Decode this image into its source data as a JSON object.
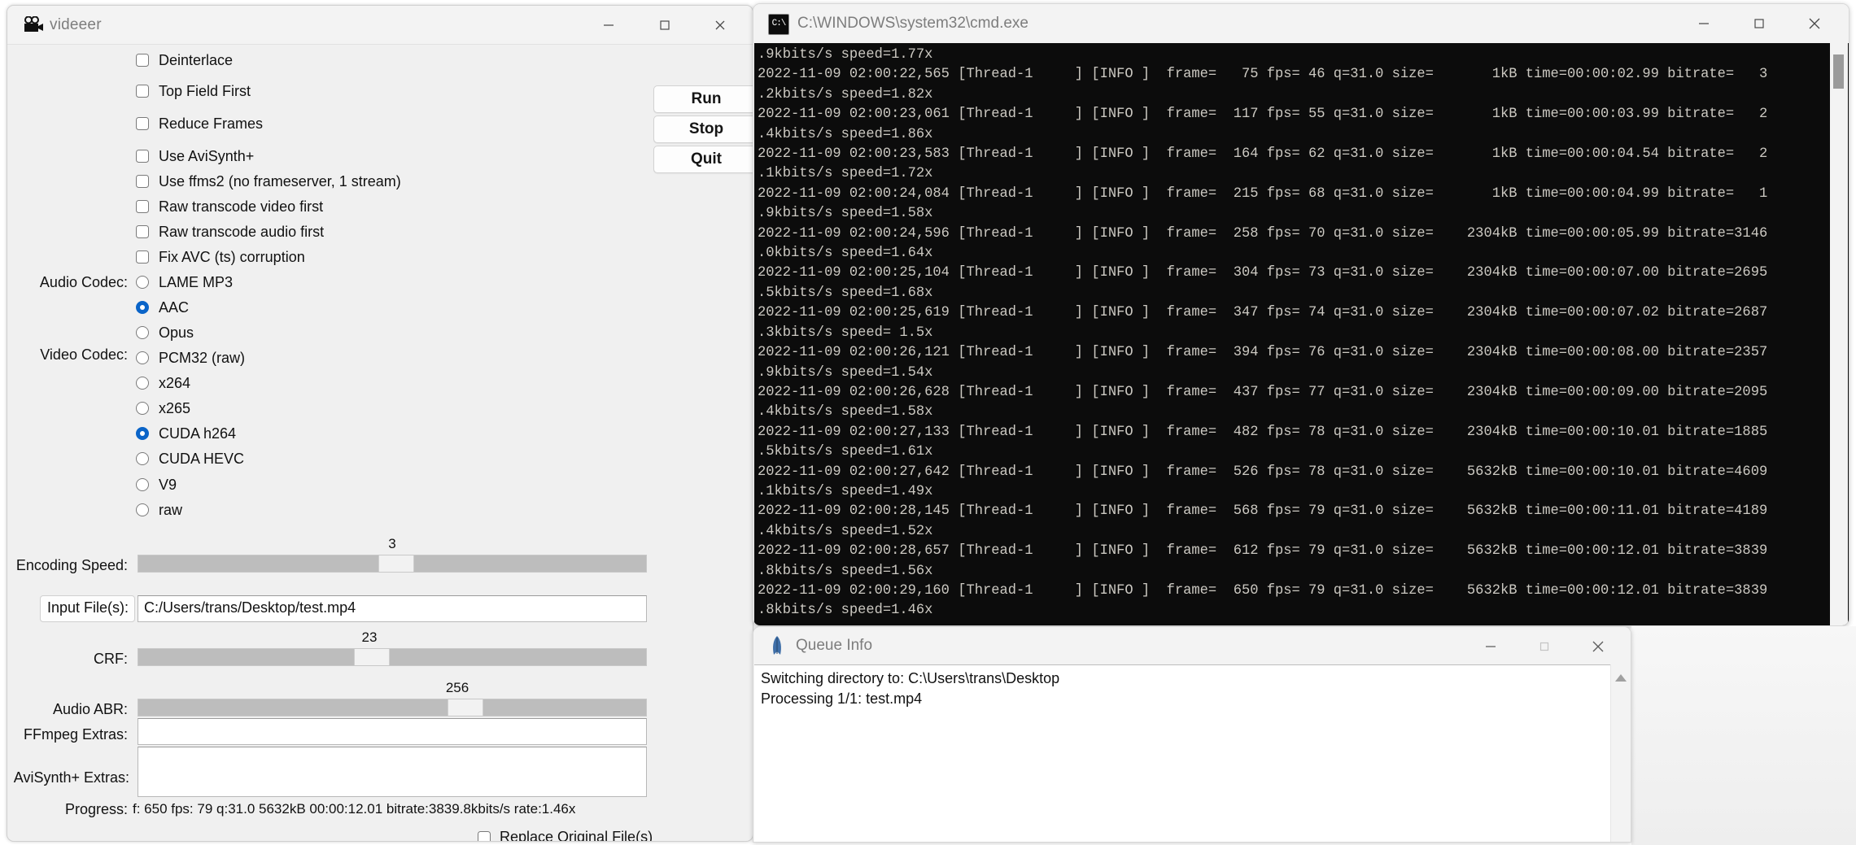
{
  "videeer": {
    "title": "videeer",
    "icon": "video-camera-icon",
    "window_controls": {
      "minimize": "—",
      "maximize": "□",
      "close": "✕"
    },
    "checkboxes": [
      {
        "label": "Deinterlace",
        "checked": false
      },
      {
        "label": "Top Field First",
        "checked": false
      },
      {
        "label": "Reduce Frames",
        "checked": false
      },
      {
        "label": "Use AviSynth+",
        "checked": false
      },
      {
        "label": "Use ffms2 (no frameserver, 1 stream)",
        "checked": false
      },
      {
        "label": "Raw transcode video first",
        "checked": false
      },
      {
        "label": "Raw transcode audio first",
        "checked": false
      },
      {
        "label": "Fix AVC (ts) corruption",
        "checked": false
      }
    ],
    "audio_codec_label": "Audio Codec:",
    "video_codec_label": "Video Codec:",
    "radios": [
      {
        "label": "LAME MP3",
        "selected": false
      },
      {
        "label": "AAC",
        "selected": true
      },
      {
        "label": "Opus",
        "selected": false
      },
      {
        "label": "PCM32 (raw)",
        "selected": false
      },
      {
        "label": "x264",
        "selected": false
      },
      {
        "label": "x265",
        "selected": false
      },
      {
        "label": "CUDA h264",
        "selected": true
      },
      {
        "label": "CUDA HEVC",
        "selected": false
      },
      {
        "label": "V9",
        "selected": false
      },
      {
        "label": "raw",
        "selected": false
      }
    ],
    "buttons": {
      "run": "Run",
      "stop": "Stop",
      "quit": "Quit"
    },
    "sliders": [
      {
        "name": "Encoding Speed:",
        "value": "3"
      },
      {
        "name": "CRF:",
        "value": "23"
      },
      {
        "name": "Audio ABR:",
        "value": "256"
      }
    ],
    "input_file_label": "Input File(s):",
    "input_file_value": "C:/Users/trans/Desktop/test.mp4",
    "ffmpeg_extras_label": "FFmpeg Extras:",
    "ffmpeg_extras_value": "",
    "avisynth_extras_label": "AviSynth+ Extras:",
    "avisynth_extras_value": "",
    "progress_label": "Progress:",
    "progress_text": "f:  650 fps: 79 q:31.0  5632kB 00:00:12.01 bitrate:3839.8kbits/s rate:1.46x",
    "replace_original_label": "Replace Original File(s)",
    "replace_original_checked": false,
    "accent_color": "#0a64c8"
  },
  "cmd": {
    "title": "C:\\WINDOWS\\system32\\cmd.exe",
    "icon": "console-icon",
    "window_controls": {
      "minimize": "—",
      "maximize": "□",
      "close": "✕"
    },
    "lines": [
      ".9kbits/s speed=1.77x",
      "2022-11-09 02:00:22,565 [Thread-1     ] [INFO ]  frame=   75 fps= 46 q=31.0 size=       1kB time=00:00:02.99 bitrate=   3",
      ".2kbits/s speed=1.82x",
      "2022-11-09 02:00:23,061 [Thread-1     ] [INFO ]  frame=  117 fps= 55 q=31.0 size=       1kB time=00:00:03.99 bitrate=   2",
      ".4kbits/s speed=1.86x",
      "2022-11-09 02:00:23,583 [Thread-1     ] [INFO ]  frame=  164 fps= 62 q=31.0 size=       1kB time=00:00:04.54 bitrate=   2",
      ".1kbits/s speed=1.72x",
      "2022-11-09 02:00:24,084 [Thread-1     ] [INFO ]  frame=  215 fps= 68 q=31.0 size=       1kB time=00:00:04.99 bitrate=   1",
      ".9kbits/s speed=1.58x",
      "2022-11-09 02:00:24,596 [Thread-1     ] [INFO ]  frame=  258 fps= 70 q=31.0 size=    2304kB time=00:00:05.99 bitrate=3146",
      ".0kbits/s speed=1.64x",
      "2022-11-09 02:00:25,104 [Thread-1     ] [INFO ]  frame=  304 fps= 73 q=31.0 size=    2304kB time=00:00:07.00 bitrate=2695",
      ".5kbits/s speed=1.68x",
      "2022-11-09 02:00:25,619 [Thread-1     ] [INFO ]  frame=  347 fps= 74 q=31.0 size=    2304kB time=00:00:07.02 bitrate=2687",
      ".3kbits/s speed= 1.5x",
      "2022-11-09 02:00:26,121 [Thread-1     ] [INFO ]  frame=  394 fps= 76 q=31.0 size=    2304kB time=00:00:08.00 bitrate=2357",
      ".9kbits/s speed=1.54x",
      "2022-11-09 02:00:26,628 [Thread-1     ] [INFO ]  frame=  437 fps= 77 q=31.0 size=    2304kB time=00:00:09.00 bitrate=2095",
      ".4kbits/s speed=1.58x",
      "2022-11-09 02:00:27,133 [Thread-1     ] [INFO ]  frame=  482 fps= 78 q=31.0 size=    2304kB time=00:00:10.01 bitrate=1885",
      ".5kbits/s speed=1.61x",
      "2022-11-09 02:00:27,642 [Thread-1     ] [INFO ]  frame=  526 fps= 78 q=31.0 size=    5632kB time=00:00:10.01 bitrate=4609",
      ".1kbits/s speed=1.49x",
      "2022-11-09 02:00:28,145 [Thread-1     ] [INFO ]  frame=  568 fps= 79 q=31.0 size=    5632kB time=00:00:11.01 bitrate=4189",
      ".4kbits/s speed=1.52x",
      "2022-11-09 02:00:28,657 [Thread-1     ] [INFO ]  frame=  612 fps= 79 q=31.0 size=    5632kB time=00:00:12.01 bitrate=3839",
      ".8kbits/s speed=1.56x",
      "2022-11-09 02:00:29,160 [Thread-1     ] [INFO ]  frame=  650 fps= 79 q=31.0 size=    5632kB time=00:00:12.01 bitrate=3839",
      ".8kbits/s speed=1.46x"
    ]
  },
  "queue": {
    "title": "Queue Info",
    "icon": "python-feather-icon",
    "window_controls": {
      "minimize": "—",
      "maximize": "□",
      "close": "✕"
    },
    "lines": [
      "Switching directory to: C:\\Users\\trans\\Desktop",
      "Processing 1/1: test.mp4"
    ]
  }
}
